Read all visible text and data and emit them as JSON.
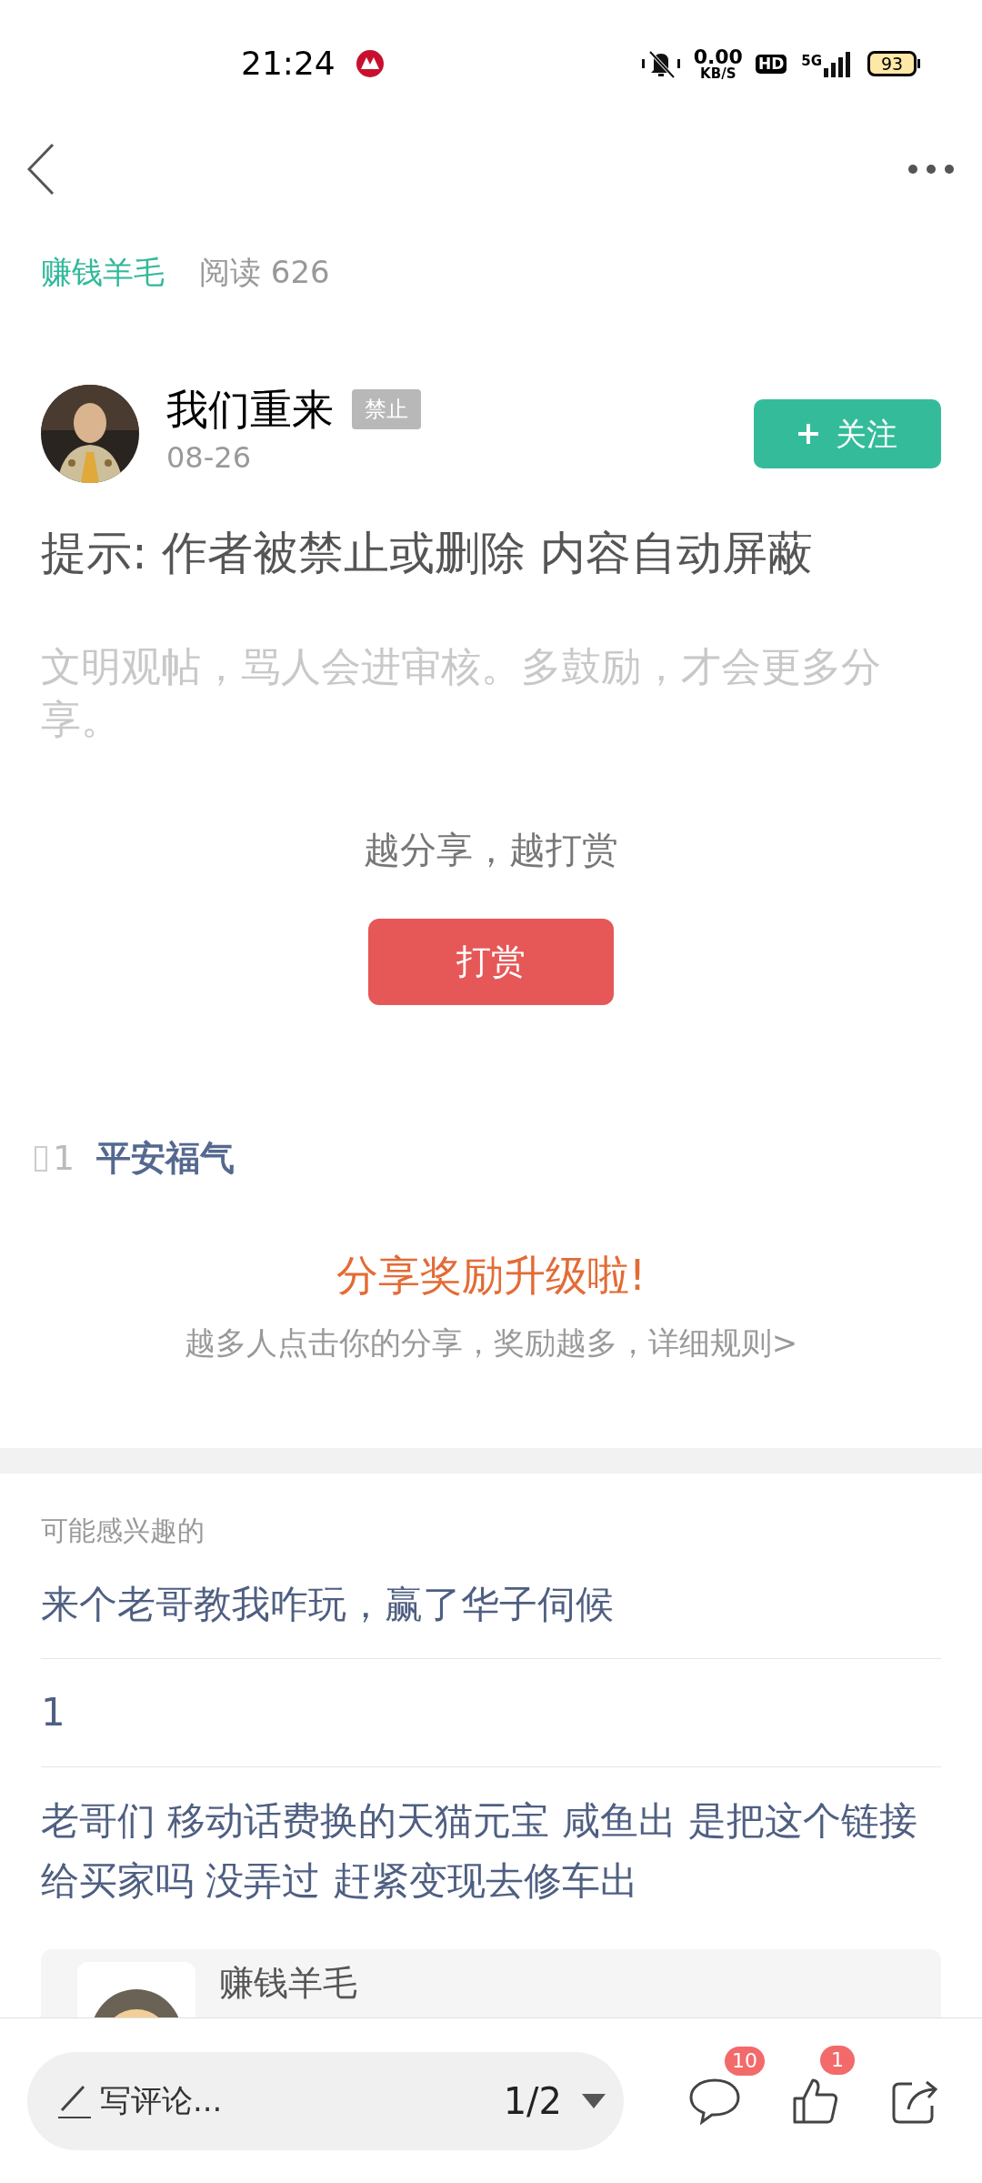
{
  "status_bar": {
    "time": "21:24",
    "speed_value": "0.00",
    "speed_unit": "KB/S",
    "hd": "HD",
    "network": "5G",
    "battery": "93"
  },
  "header": {
    "category": "赚钱羊毛",
    "reads": "阅读 626"
  },
  "author": {
    "name": "我们重来",
    "badge": "禁止",
    "date": "08-26",
    "follow_button": "关注"
  },
  "notice": "提示: 作者被禁止或删除 内容自动屏蔽",
  "hint": "文明观帖，骂人会进审核。多鼓励，才会更多分享。",
  "reward": {
    "caption": "越分享，越打赏",
    "button": "打赏"
  },
  "tip_entry": {
    "count": "1",
    "name": "平安福气"
  },
  "share_promo": {
    "title": "分享奖励升级啦!",
    "subtitle": "越多人点击你的分享，奖励越多，详细规则>"
  },
  "related": {
    "heading": "可能感兴趣的",
    "items": [
      {
        "title": "来个老哥教我咋玩，赢了华子伺候"
      },
      {
        "title": "1"
      },
      {
        "title": "老哥们 移动话费换的天猫元宝 咸鱼出 是把这个链接给买家吗 没弄过 赶紧变现去修车出"
      }
    ]
  },
  "card": {
    "name": "赚钱羊毛"
  },
  "bottom_bar": {
    "comment_placeholder": "写评论...",
    "page": "1/2",
    "comment_count": "10",
    "like_count": "1"
  }
}
